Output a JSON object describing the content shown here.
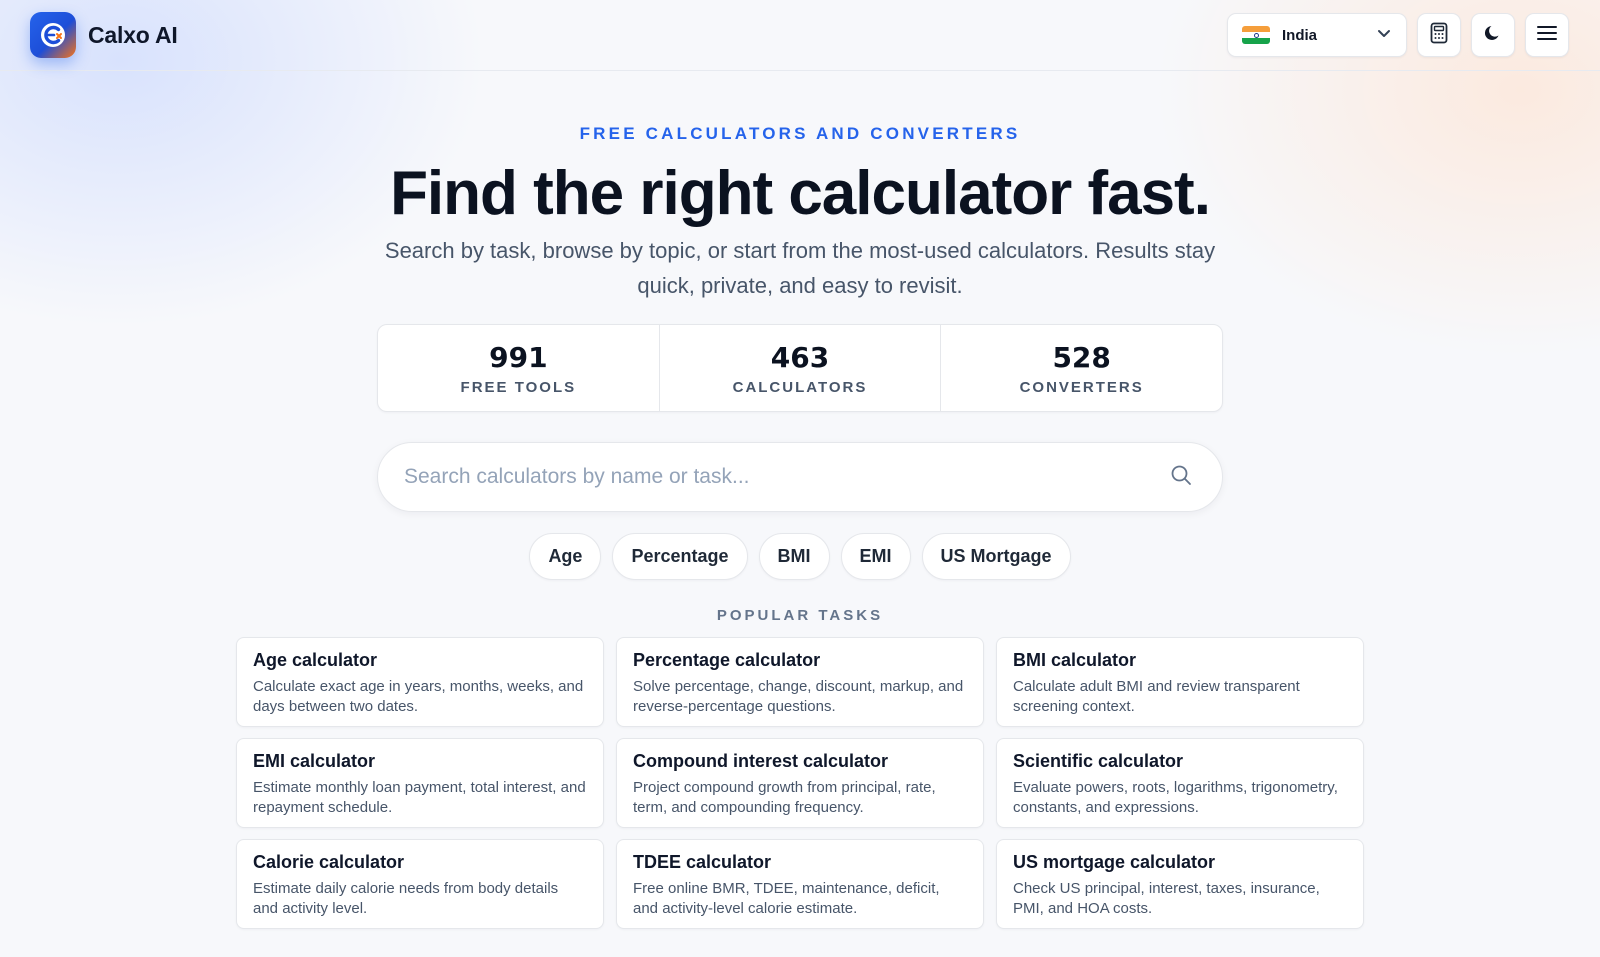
{
  "brand": {
    "name": "Calxo AI"
  },
  "header": {
    "country": "India",
    "calculator_button": "calculator-icon",
    "theme_button": "moon-icon",
    "menu_button": "menu-icon"
  },
  "hero": {
    "eyebrow": "FREE CALCULATORS AND CONVERTERS",
    "title": "Find the right calculator fast.",
    "subtitle": "Search by task, browse by topic, or start from the most-used calculators. Results stay quick, private, and easy to revisit."
  },
  "stats": [
    {
      "value": "991",
      "label": "FREE TOOLS"
    },
    {
      "value": "463",
      "label": "CALCULATORS"
    },
    {
      "value": "528",
      "label": "CONVERTERS"
    }
  ],
  "search": {
    "placeholder": "Search calculators by name or task...",
    "value": ""
  },
  "chips": [
    "Age",
    "Percentage",
    "BMI",
    "EMI",
    "US Mortgage"
  ],
  "popular": {
    "label": "POPULAR TASKS",
    "tasks": [
      {
        "title": "Age calculator",
        "desc": "Calculate exact age in years, months, weeks, and days between two dates."
      },
      {
        "title": "Percentage calculator",
        "desc": "Solve percentage, change, discount, markup, and reverse-percentage questions."
      },
      {
        "title": "BMI calculator",
        "desc": "Calculate adult BMI and review transparent screening context."
      },
      {
        "title": "EMI calculator",
        "desc": "Estimate monthly loan payment, total interest, and repayment schedule."
      },
      {
        "title": "Compound interest calculator",
        "desc": "Project compound growth from principal, rate, term, and compounding frequency."
      },
      {
        "title": "Scientific calculator",
        "desc": "Evaluate powers, roots, logarithms, trigonometry, constants, and expressions."
      },
      {
        "title": "Calorie calculator",
        "desc": "Estimate daily calorie needs from body details and activity level."
      },
      {
        "title": "TDEE calculator",
        "desc": "Free online BMR, TDEE, maintenance, deficit, and activity-level calorie estimate."
      },
      {
        "title": "US mortgage calculator",
        "desc": "Check US principal, interest, taxes, insurance, PMI, and HOA costs."
      }
    ]
  },
  "colors": {
    "accent": "#2563eb",
    "text": "#0f172a",
    "muted": "#475569",
    "border": "#e5e7eb"
  }
}
